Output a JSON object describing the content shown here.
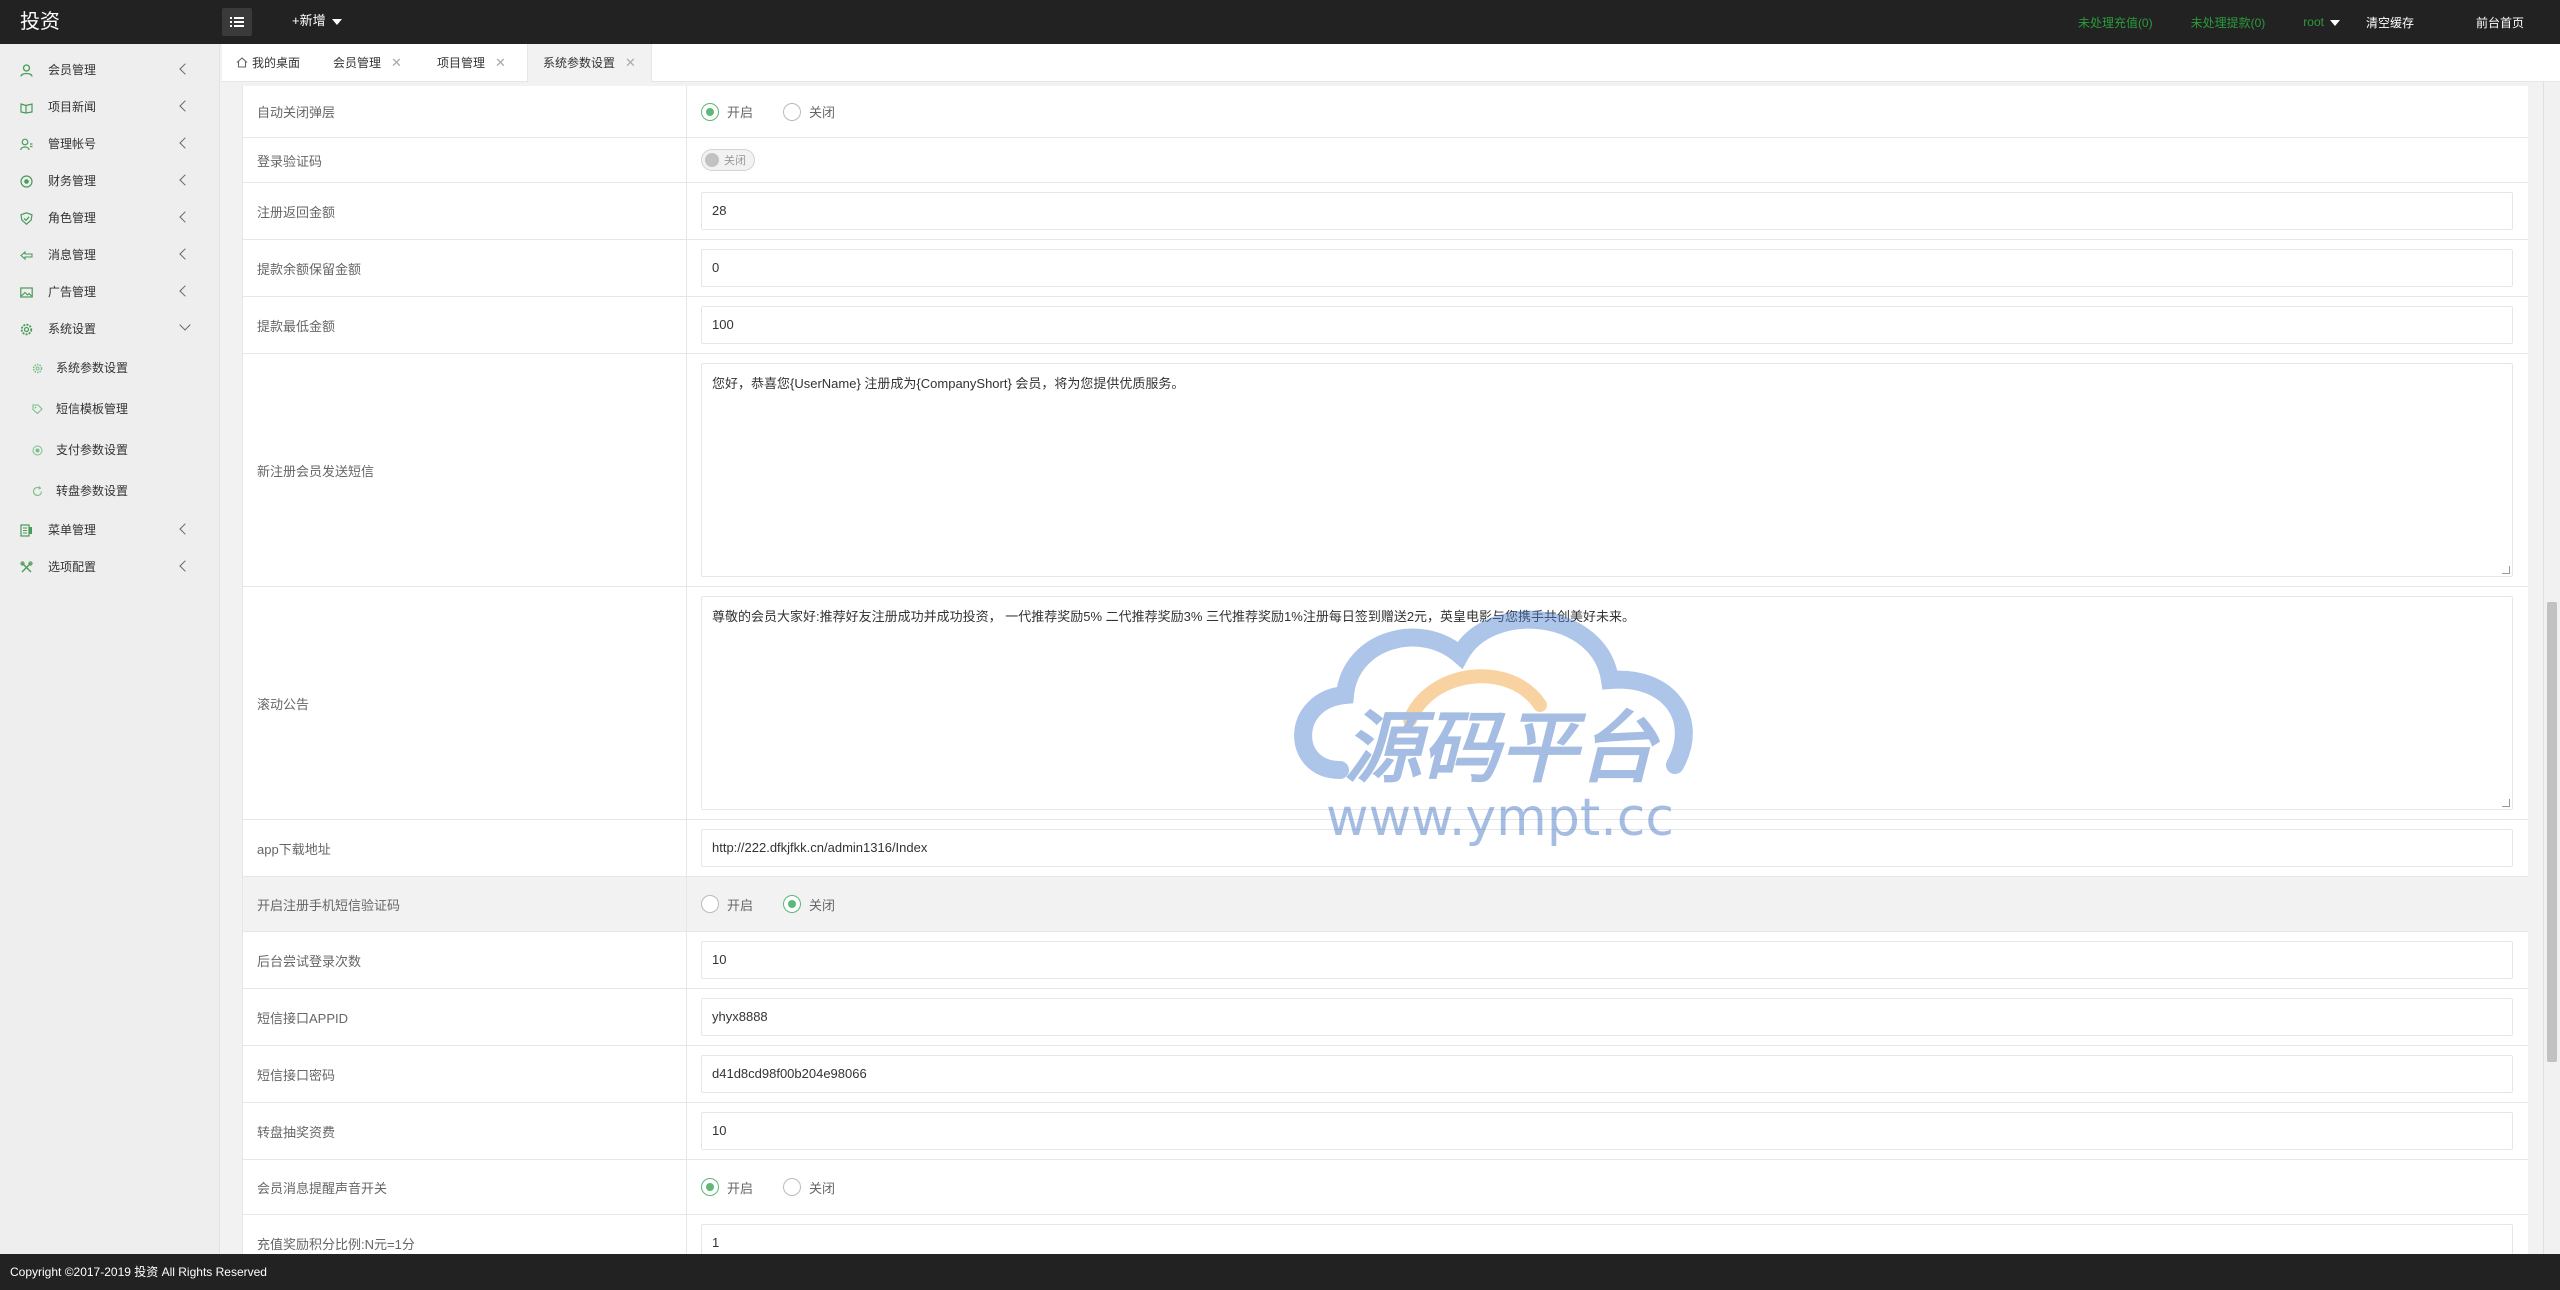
{
  "header": {
    "logo": "投资",
    "add_new": "+新增",
    "links": [
      {
        "label": "未处理充值(0)",
        "color": "#2c9a3c"
      },
      {
        "label": "未处理提款(0)",
        "color": "#2c9a3c"
      },
      {
        "label": "root",
        "color": "#2c9a3c"
      },
      {
        "label": "清空缓存",
        "color": "#ffffff"
      },
      {
        "label": "前台首页",
        "color": "#ffffff"
      }
    ]
  },
  "sidebar": {
    "items": [
      {
        "label": "会员管理",
        "icon": "user-icon"
      },
      {
        "label": "项目新闻",
        "icon": "book-icon"
      },
      {
        "label": "管理帐号",
        "icon": "admin-icon"
      },
      {
        "label": "财务管理",
        "icon": "money-icon"
      },
      {
        "label": "角色管理",
        "icon": "shield-icon"
      },
      {
        "label": "消息管理",
        "icon": "message-icon"
      },
      {
        "label": "广告管理",
        "icon": "image-icon"
      },
      {
        "label": "系统设置",
        "icon": "gear-icon"
      }
    ],
    "subitems": [
      {
        "label": "系统参数设置"
      },
      {
        "label": "短信模板管理"
      },
      {
        "label": "支付参数设置"
      },
      {
        "label": "转盘参数设置"
      }
    ],
    "items_after": [
      {
        "label": "菜单管理",
        "icon": "menu-icon"
      },
      {
        "label": "选项配置",
        "icon": "wrench-icon"
      }
    ]
  },
  "tabs": [
    {
      "label": "我的桌面",
      "icon": "home-icon"
    },
    {
      "label": "会员管理"
    },
    {
      "label": "项目管理"
    },
    {
      "label": "系统参数设置",
      "active": true
    }
  ],
  "form": {
    "rows": [
      {
        "label": "自动关闭弹层",
        "type": "radio",
        "options": [
          "开启",
          "关闭"
        ],
        "selected": "开启"
      },
      {
        "label": "登录验证码",
        "type": "switch",
        "value": "关闭"
      },
      {
        "label": "注册返回金额",
        "type": "input",
        "value": "28"
      },
      {
        "label": "提款余额保留金额",
        "type": "input",
        "value": "0"
      },
      {
        "label": "提款最低金额",
        "type": "input",
        "value": "100"
      },
      {
        "label": "新注册会员发送短信",
        "type": "textarea",
        "value": "您好，恭喜您{UserName} 注册成为{CompanyShort} 会员，将为您提供优质服务。"
      },
      {
        "label": "滚动公告",
        "type": "textarea",
        "value": "尊敬的会员大家好:推荐好友注册成功并成功投资， 一代推荐奖励5%  二代推荐奖励3%  三代推荐奖励1%注册每日签到赠送2元，英皇电影与您携手共创美好未来。"
      },
      {
        "label": "app下载地址",
        "type": "input",
        "value": "http://222.dfkjfkk.cn/admin1316/Index"
      },
      {
        "label": "开启注册手机短信验证码",
        "type": "radio",
        "options": [
          "开启",
          "关闭"
        ],
        "selected": "关闭",
        "shaded": true
      },
      {
        "label": "后台尝试登录次数",
        "type": "input",
        "value": "10"
      },
      {
        "label": "短信接口APPID",
        "type": "input",
        "value": "yhyx8888"
      },
      {
        "label": "短信接口密码",
        "type": "input",
        "value": "d41d8cd98f00b204e98066"
      },
      {
        "label": "转盘抽奖资费",
        "type": "input",
        "value": "10"
      },
      {
        "label": "会员消息提醒声音开关",
        "type": "radio",
        "options": [
          "开启",
          "关闭"
        ],
        "selected": "开启"
      },
      {
        "label": "充值奖励积分比例:N元=1分",
        "type": "input",
        "value": "1"
      }
    ]
  },
  "watermark": {
    "title": "源码平台",
    "url": "www.ympt.cc"
  },
  "footer": {
    "copyright": "Copyright ©2017-2019 投资 All Rights Reserved"
  },
  "colors": {
    "accent_green": "#5FB878",
    "header_bg": "#222222",
    "link_green": "#2c9a3c"
  }
}
